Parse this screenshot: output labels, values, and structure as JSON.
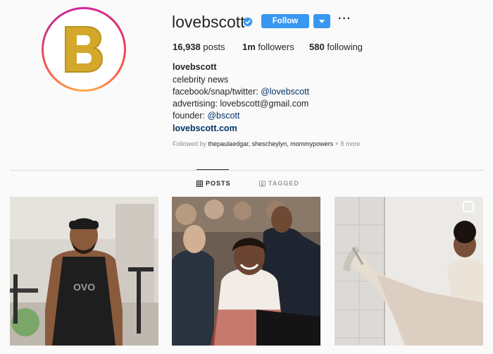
{
  "profile": {
    "username": "lovebscott",
    "follow_label": "Follow",
    "more_label": "···",
    "stats": {
      "posts_count": "16,938",
      "posts_label": "posts",
      "followers_count": "1m",
      "followers_label": "followers",
      "following_count": "580",
      "following_label": "following"
    },
    "bio": {
      "full_name": "lovebscott",
      "line1": "celebrity news",
      "line2_prefix": "facebook/snap/twitter: ",
      "line2_link": "@lovebscott",
      "line3": "advertising: lovebscott@gmail.com",
      "line4_prefix": "founder: ",
      "line4_link": "@bscott",
      "website": "lovebscott.com"
    },
    "followed_by": {
      "prefix": "Followed by ",
      "names": "thepaulaedgar, shescheylyn, mommypowers",
      "more": " + 8 more"
    }
  },
  "tabs": [
    {
      "label": "POSTS",
      "icon": "grid-icon",
      "active": true
    },
    {
      "label": "TAGGED",
      "icon": "tag-icon",
      "active": false
    }
  ],
  "colors": {
    "accent": "#3897f0",
    "link": "#003569",
    "logo_gold": "#d4a82a",
    "background": "#fafafa"
  }
}
